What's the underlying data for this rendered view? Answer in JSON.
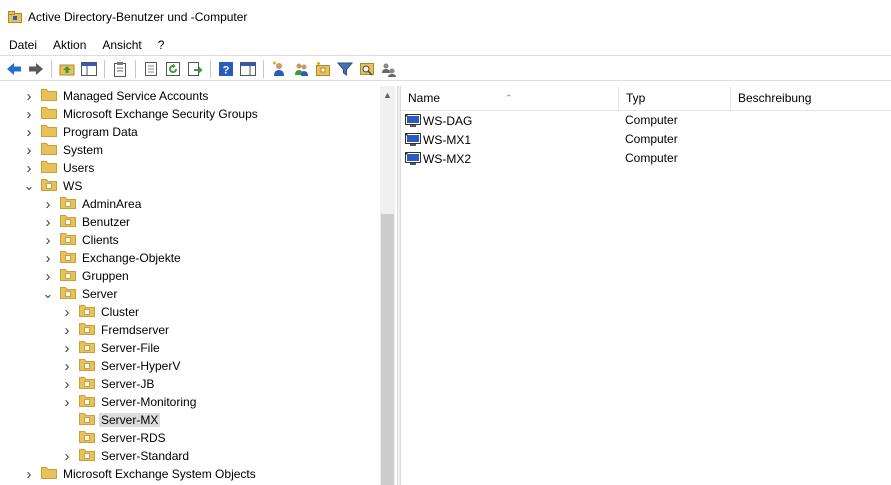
{
  "window": {
    "title": "Active Directory-Benutzer und -Computer"
  },
  "menu": [
    "Datei",
    "Aktion",
    "Ansicht",
    "?"
  ],
  "tree": [
    {
      "label": "Managed Service Accounts",
      "level": 0,
      "expander": "right"
    },
    {
      "label": "Microsoft Exchange Security Groups",
      "level": 0,
      "expander": "right"
    },
    {
      "label": "Program Data",
      "level": 0,
      "expander": "right"
    },
    {
      "label": "System",
      "level": 0,
      "expander": "right"
    },
    {
      "label": "Users",
      "level": 0,
      "expander": "right"
    },
    {
      "label": "WS",
      "level": 0,
      "expander": "down"
    },
    {
      "label": "AdminArea",
      "level": 1,
      "expander": "right"
    },
    {
      "label": "Benutzer",
      "level": 1,
      "expander": "right"
    },
    {
      "label": "Clients",
      "level": 1,
      "expander": "right"
    },
    {
      "label": "Exchange-Objekte",
      "level": 1,
      "expander": "right"
    },
    {
      "label": "Gruppen",
      "level": 1,
      "expander": "right"
    },
    {
      "label": "Server",
      "level": 1,
      "expander": "down"
    },
    {
      "label": "Cluster",
      "level": 2,
      "expander": "right"
    },
    {
      "label": "Fremdserver",
      "level": 2,
      "expander": "right"
    },
    {
      "label": "Server-File",
      "level": 2,
      "expander": "right"
    },
    {
      "label": "Server-HyperV",
      "level": 2,
      "expander": "right"
    },
    {
      "label": "Server-JB",
      "level": 2,
      "expander": "right"
    },
    {
      "label": "Server-Monitoring",
      "level": 2,
      "expander": "right"
    },
    {
      "label": "Server-MX",
      "level": 2,
      "expander": "none",
      "selected": true
    },
    {
      "label": "Server-RDS",
      "level": 2,
      "expander": "none"
    },
    {
      "label": "Server-Standard",
      "level": 2,
      "expander": "right"
    },
    {
      "label": "Microsoft Exchange System Objects",
      "level": 0,
      "expander": "right"
    }
  ],
  "list": {
    "columns": [
      "Name",
      "Typ",
      "Beschreibung"
    ],
    "rows": [
      {
        "name": "WS-DAG",
        "type": "Computer"
      },
      {
        "name": "WS-MX1",
        "type": "Computer"
      },
      {
        "name": "WS-MX2",
        "type": "Computer"
      }
    ]
  },
  "toolbar_icons": [
    "back-arrow-icon",
    "forward-arrow-icon",
    "sep",
    "up-folder-icon",
    "show-hide-tree-icon",
    "sep",
    "clipboard-icon",
    "sep",
    "properties-icon",
    "refresh-icon",
    "export-list-icon",
    "sep",
    "help-icon",
    "show-hide-action-pane-icon",
    "sep",
    "new-user-icon",
    "new-group-icon",
    "new-ou-icon",
    "filter-icon",
    "find-icon",
    "delegate-control-icon"
  ],
  "colors": {
    "folder": "#e8c15a",
    "folder_dark": "#c9a13a",
    "arrow_blue": "#1f6fd1",
    "selection": "#dcdcdc"
  }
}
